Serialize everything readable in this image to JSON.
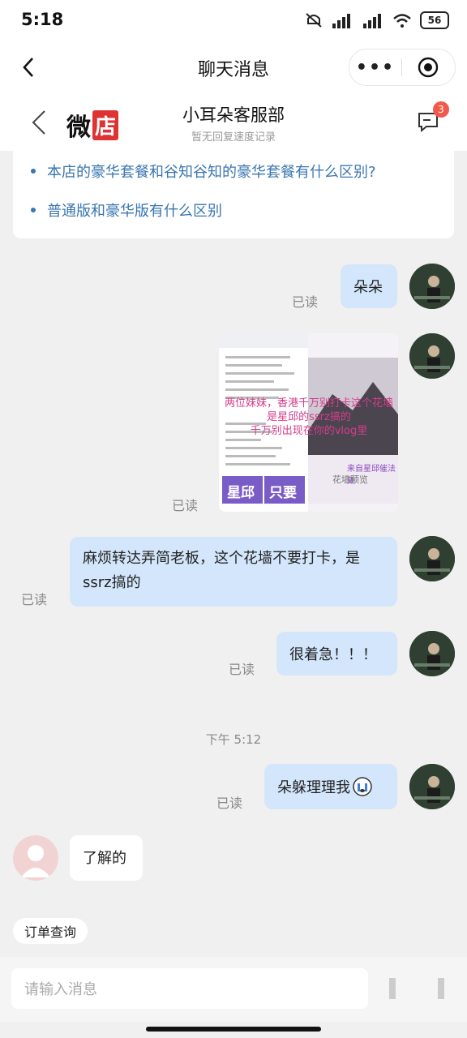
{
  "status_bar": {
    "time": "5:18",
    "battery": "56",
    "signal1": "HD",
    "signal2": "HD"
  },
  "nav": {
    "title": "聊天消息",
    "more": "•••"
  },
  "shop": {
    "logo_w": "微",
    "logo_d": "店",
    "name": "小耳朵客服部",
    "subtitle": "暂无回复速度记录",
    "badge": "3"
  },
  "faq": [
    "本店的豪华套餐和谷知谷知的豪华套餐有什么区别?",
    "普通版和豪华版有什么区别"
  ],
  "messages": {
    "m1": {
      "text": "朵朵",
      "read": "已读"
    },
    "m2": {
      "read": "已读",
      "overlay": [
        "两位妹妹，香港千万别打卡这个花墙",
        "是星邱的ssrz搞的",
        "千万别出现在你的vlog里"
      ],
      "caption": "来自星邱催法集",
      "caption2": "花墙预览",
      "stickers": [
        "星邱",
        "只要"
      ]
    },
    "m3": {
      "text": "麻烦转达弄简老板，这个花墙不要打卡，是ssrz搞的",
      "read": "已读"
    },
    "m4": {
      "text": "很着急！！！",
      "read": "已读"
    },
    "timestamp": "下午 5:12",
    "m5": {
      "text": "朵躲理理我",
      "read": "已读"
    },
    "m6": {
      "text": "了解的"
    }
  },
  "footer": {
    "chip": "订单查询",
    "placeholder": "请输入消息"
  },
  "colors": {
    "bubble_self": "#d3e6fb",
    "link": "#3a76b0",
    "badge": "#f05a4a"
  }
}
